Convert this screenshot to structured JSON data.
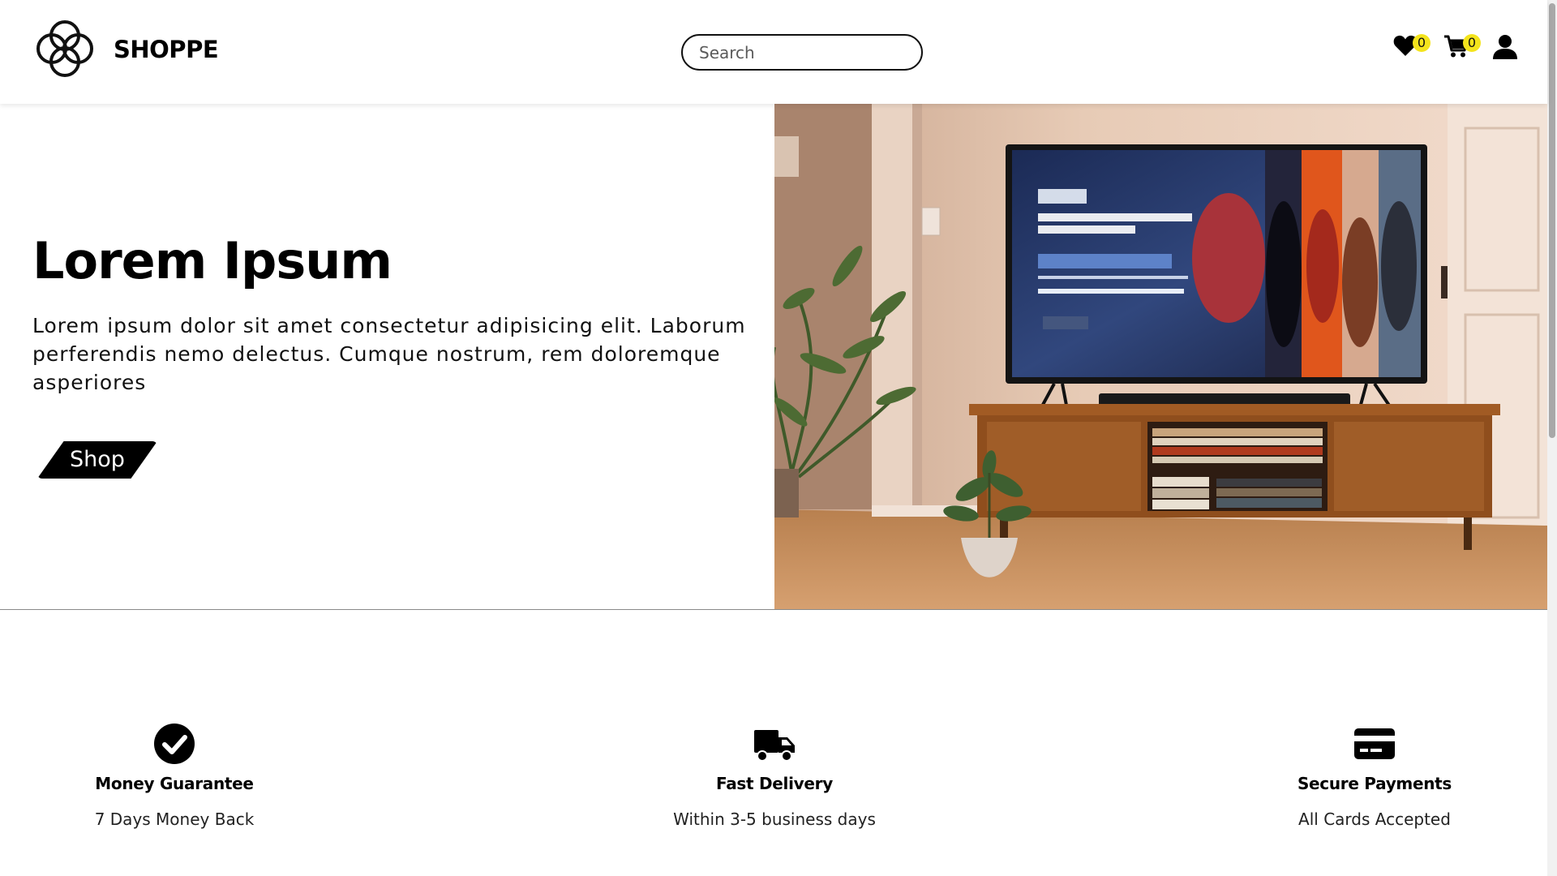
{
  "header": {
    "brand": "SHOPPE",
    "search_placeholder": "Search",
    "wishlist_count": "0",
    "cart_count": "0",
    "icons": [
      "logo-icon",
      "heart-icon",
      "cart-icon",
      "user-icon"
    ]
  },
  "hero": {
    "title": "Lorem Ipsum",
    "text": "Lorem ipsum dolor sit amet consectetur adipisicing elit. Laborum perferendis nemo delectus. Cumque nostrum, rem doloremque asperiores",
    "button_label": "Shop",
    "image": "photo of a TV on a wooden media console showing a streaming service home screen"
  },
  "features": [
    {
      "icon": "check-circle-icon",
      "title": "Money Guarantee",
      "subtitle": "7 Days Money Back"
    },
    {
      "icon": "truck-icon",
      "title": "Fast Delivery",
      "subtitle": "Within 3-5 business days"
    },
    {
      "icon": "credit-card-icon",
      "title": "Secure Payments",
      "subtitle": "All Cards Accepted"
    }
  ],
  "colors": {
    "badge": "#f4e41c",
    "text": "#000000",
    "background": "#ffffff"
  }
}
